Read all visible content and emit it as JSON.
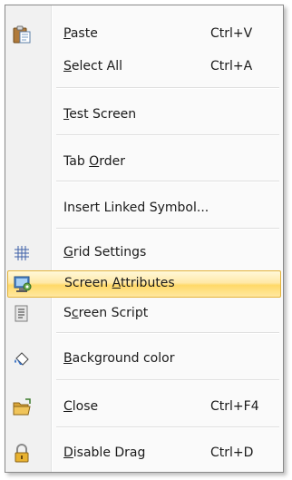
{
  "menu": {
    "items": [
      {
        "name": "paste",
        "pre": "",
        "acc": "P",
        "post": "aste",
        "shortcut": "Ctrl+V",
        "icon": "clipboard-paste-icon"
      },
      {
        "name": "select-all",
        "pre": "",
        "acc": "S",
        "post": "elect All",
        "shortcut": "Ctrl+A",
        "icon": ""
      },
      {
        "name": "test-screen",
        "pre": "",
        "acc": "T",
        "post": "est Screen",
        "shortcut": "",
        "icon": ""
      },
      {
        "name": "tab-order",
        "pre": "Tab ",
        "acc": "O",
        "post": "rder",
        "shortcut": "",
        "icon": ""
      },
      {
        "name": "insert-linked-symbol",
        "pre": "Insert Linked Symbol...",
        "acc": "",
        "post": "",
        "shortcut": "",
        "icon": ""
      },
      {
        "name": "grid-settings",
        "pre": "",
        "acc": "G",
        "post": "rid Settings",
        "shortcut": "",
        "icon": "grid-icon"
      },
      {
        "name": "screen-attributes",
        "pre": "Screen ",
        "acc": "A",
        "post": "ttributes",
        "shortcut": "",
        "icon": "screen-attributes-icon",
        "highlighted": true
      },
      {
        "name": "screen-script",
        "pre": "S",
        "acc": "c",
        "post": "reen Script",
        "shortcut": "",
        "icon": "script-icon"
      },
      {
        "name": "background-color",
        "pre": "",
        "acc": "B",
        "post": "ackground color",
        "shortcut": "",
        "icon": "paint-bucket-icon"
      },
      {
        "name": "close",
        "pre": "",
        "acc": "C",
        "post": "lose",
        "shortcut": "Ctrl+F4",
        "icon": "folder-close-icon"
      },
      {
        "name": "disable-drag",
        "pre": "",
        "acc": "D",
        "post": "isable Drag",
        "shortcut": "Ctrl+D",
        "icon": "lock-icon"
      }
    ]
  },
  "colors": {
    "highlight_border": "#e3b33c",
    "highlight_fill": "#ffe08a",
    "gutter": "#f1f1f1"
  }
}
